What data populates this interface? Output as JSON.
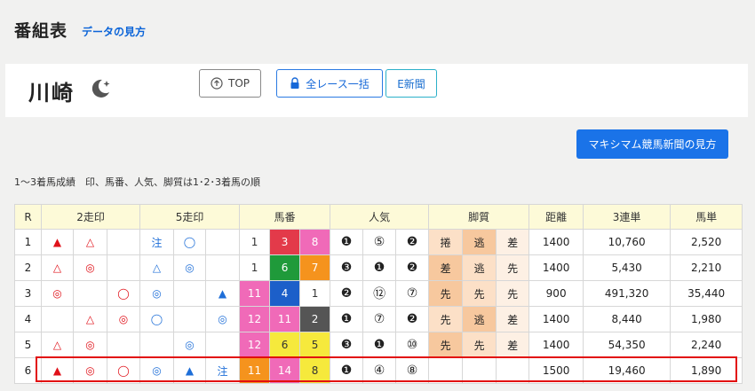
{
  "header": {
    "title": "番組表",
    "link": "データの見方"
  },
  "venue": {
    "name": "川崎",
    "icon": "night-moon-icon"
  },
  "buttons": {
    "top": "TOP",
    "all_race": "全レース一括",
    "e_newspaper": "E新聞",
    "maxim_guide": "マキシマム競馬新聞の見方"
  },
  "note": "1〜3着馬成績　印、馬番、人気、脚質は1･2･3着馬の順",
  "table": {
    "headers": [
      "R",
      "2走印",
      "5走印",
      "馬番",
      "人気",
      "脚質",
      "距離",
      "3連単",
      "馬単"
    ],
    "rows": [
      {
        "r": "1",
        "m2": [
          "▲",
          "△",
          ""
        ],
        "m5": [
          "注",
          "◯",
          ""
        ],
        "num": [
          "1",
          "3",
          "8"
        ],
        "pop": [
          "❶",
          "⑤",
          "❷"
        ],
        "style": [
          "捲",
          "逃",
          "差"
        ],
        "dist": "1400",
        "tri": "10,760",
        "exa": "2,520"
      },
      {
        "r": "2",
        "m2": [
          "△",
          "◎",
          ""
        ],
        "m5": [
          "△",
          "◎",
          ""
        ],
        "num": [
          "1",
          "6",
          "7"
        ],
        "pop": [
          "❸",
          "❶",
          "❷"
        ],
        "style": [
          "差",
          "逃",
          "先"
        ],
        "dist": "1400",
        "tri": "5,430",
        "exa": "2,210"
      },
      {
        "r": "3",
        "m2": [
          "◎",
          "",
          "◯"
        ],
        "m5": [
          "◎",
          "",
          "▲"
        ],
        "num": [
          "11",
          "4",
          "1"
        ],
        "pop": [
          "❷",
          "⑫",
          "⑦"
        ],
        "style": [
          "先",
          "先",
          "先"
        ],
        "dist": "900",
        "tri": "491,320",
        "exa": "35,440"
      },
      {
        "r": "4",
        "m2": [
          "",
          "△",
          "◎"
        ],
        "m5": [
          "◯",
          "",
          "◎"
        ],
        "num": [
          "12",
          "11",
          "2"
        ],
        "pop": [
          "❶",
          "⑦",
          "❷"
        ],
        "style": [
          "先",
          "逃",
          "差"
        ],
        "dist": "1400",
        "tri": "8,440",
        "exa": "1,980"
      },
      {
        "r": "5",
        "m2": [
          "△",
          "◎",
          ""
        ],
        "m5": [
          "",
          "◎",
          ""
        ],
        "num": [
          "12",
          "6",
          "5"
        ],
        "pop": [
          "❸",
          "❶",
          "⑩"
        ],
        "style": [
          "先",
          "先",
          "差"
        ],
        "dist": "1400",
        "tri": "54,350",
        "exa": "2,240"
      },
      {
        "r": "6",
        "m2": [
          "▲",
          "◎",
          "◯"
        ],
        "m5": [
          "◎",
          "▲",
          "注"
        ],
        "num": [
          "11",
          "14",
          "8"
        ],
        "pop": [
          "❶",
          "④",
          "⑧"
        ],
        "style": [
          "",
          "",
          ""
        ],
        "dist": "1500",
        "tri": "19,460",
        "exa": "1,890"
      }
    ]
  },
  "colors": {
    "accent": "#1a73e8",
    "highlight": "#e20e0e",
    "header_bg": "#fdfad8"
  }
}
